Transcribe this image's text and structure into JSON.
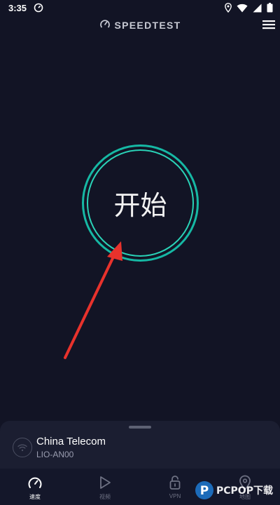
{
  "status_bar": {
    "time": "3:35",
    "icons": [
      "speedtest-notification-icon",
      "location-icon",
      "wifi-icon",
      "cellular-icon",
      "battery-icon"
    ]
  },
  "header": {
    "title": "SPEEDTEST",
    "logo_icon": "speedometer-icon",
    "menu_icon": "hamburger-menu-icon"
  },
  "start_button": {
    "label": "开始",
    "ring_color": "#16b8a4",
    "inner_ring_color": "#2ad2b7"
  },
  "annotation": {
    "type": "arrow",
    "color": "#e8322c"
  },
  "connection": {
    "provider": "China Telecom",
    "device": "LIO-AN00",
    "icon": "wifi-icon"
  },
  "bottom_nav": {
    "items": [
      {
        "label": "速度",
        "icon": "speedometer-icon",
        "active": true
      },
      {
        "label": "视频",
        "icon": "play-icon",
        "active": false
      },
      {
        "label": "VPN",
        "icon": "lock-icon",
        "active": false
      },
      {
        "label": "地图",
        "icon": "map-pin-icon",
        "active": false
      }
    ]
  },
  "watermark": {
    "text": "PCPOP下载"
  },
  "colors": {
    "background": "#121425",
    "sheet": "#1b1e31",
    "accent": "#16b8a4",
    "arrow": "#e8322c"
  }
}
